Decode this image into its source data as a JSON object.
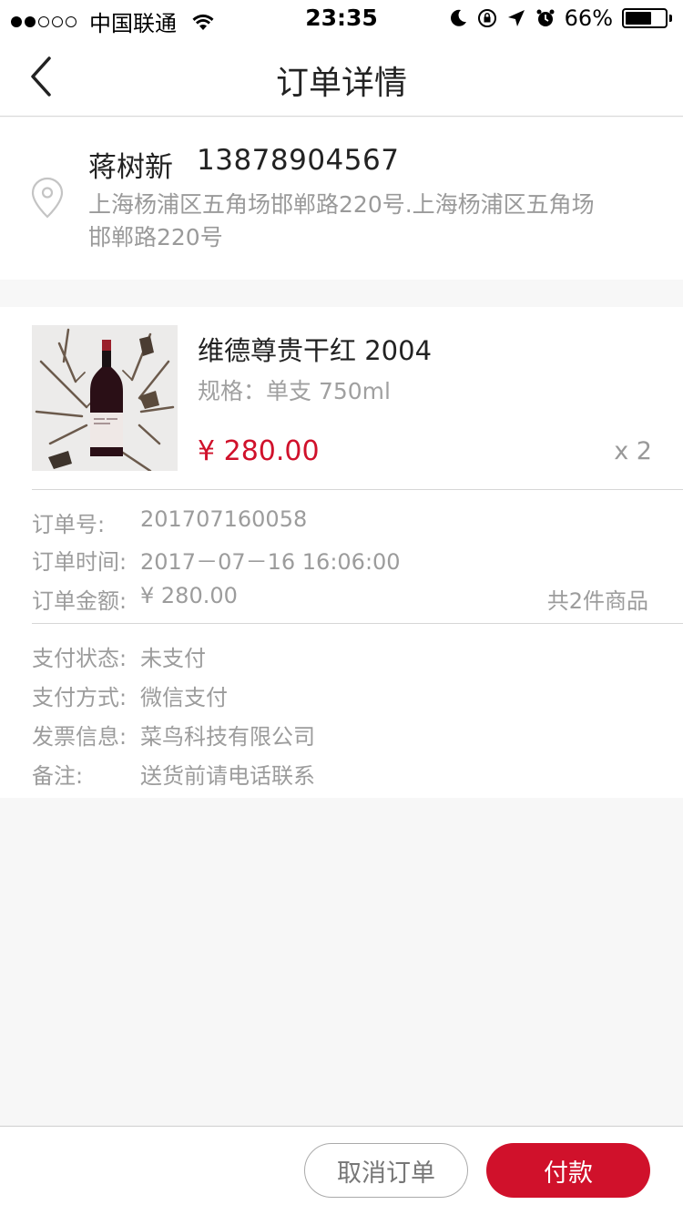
{
  "status_bar": {
    "carrier": "中国联通",
    "time": "23:35",
    "battery": "66%",
    "battery_level": 0.66,
    "signal_bars_filled": 2,
    "signal_bars_total": 5
  },
  "nav": {
    "title": "订单详情"
  },
  "address": {
    "name": "蒋树新",
    "phone": "13878904567",
    "detail": "上海杨浦区五角场邯郸路220号.上海杨浦区五角场邯郸路220号"
  },
  "product": {
    "name": "维德尊贵干红 2004",
    "spec": "规格：单支 750ml",
    "price": "¥ 280.00",
    "quantity": "x 2"
  },
  "order_info": {
    "number_label": "订单号:",
    "number_value": "201707160058",
    "time_label": "订单时间:",
    "time_value": "2017－07－16  16:06:00",
    "amount_label": "订单金额:",
    "amount_value": "¥ 280.00",
    "item_count": "共2件商品"
  },
  "payment_info": {
    "status_label": "支付状态:",
    "status_value": "未支付",
    "method_label": "支付方式:",
    "method_value": "微信支付",
    "invoice_label": "发票信息:",
    "invoice_value": "菜鸟科技有限公司",
    "note_label": "备注:",
    "note_value": "送货前请电话联系"
  },
  "actions": {
    "cancel_label": "取消订单",
    "pay_label": "付款"
  },
  "colors": {
    "accent": "#d0112b",
    "background": "#f7f7f7",
    "secondary_text": "#9c9c9c"
  },
  "icons": {
    "back": "chevron-left-icon",
    "location": "location-pin-icon",
    "wifi": "wifi-icon",
    "moon": "moon-icon",
    "orientation_lock": "orientation-lock-icon",
    "location_services": "location-arrow-icon",
    "alarm": "alarm-icon"
  }
}
